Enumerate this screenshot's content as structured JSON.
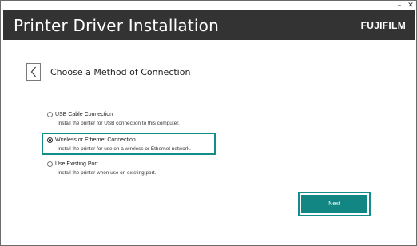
{
  "window": {
    "controls": {
      "minimize": "–",
      "close": "✕"
    }
  },
  "header": {
    "title": "Printer Driver Installation",
    "brand": "FUJIFILM",
    "background": "#333333"
  },
  "page": {
    "back_icon": "chevron-left-icon",
    "heading": "Choose a Method of Connection"
  },
  "options": [
    {
      "label": "USB Cable Connection",
      "description": "Install the printer for USB connection to this computer.",
      "selected": false
    },
    {
      "label": "Wireless or Ethernet Connection",
      "description": "Install the printer for use on a wireless or Ethernet network.",
      "selected": true
    },
    {
      "label": "Use Existing Port",
      "description": "Install the printer when use on existing port.",
      "selected": false
    }
  ],
  "actions": {
    "next_label": "Next"
  },
  "colors": {
    "accent": "#148c89",
    "next_button": "#118682"
  }
}
